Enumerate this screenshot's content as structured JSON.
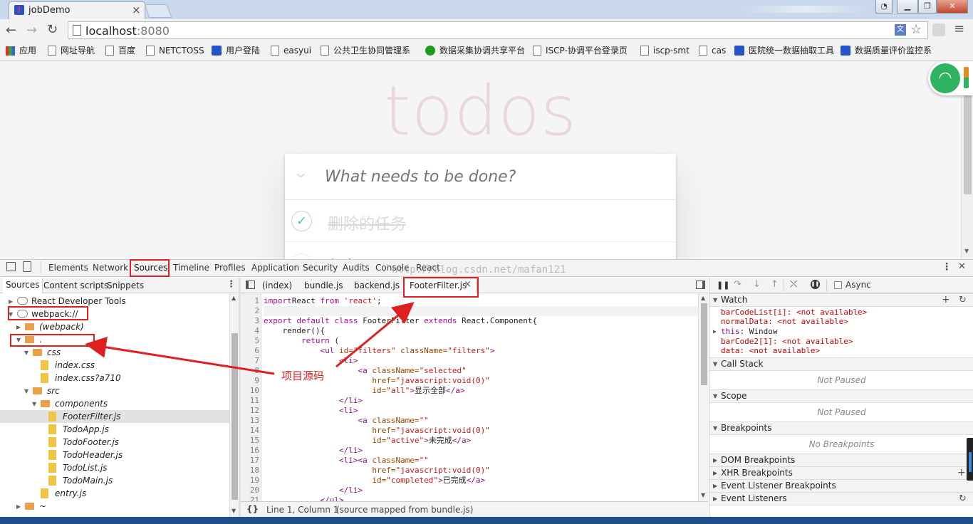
{
  "browser": {
    "tab_title": "jobDemo",
    "tab_close": "×",
    "url_host": "localhost",
    "url_port": ":8080",
    "bookmarks": [
      "应用",
      "网址导航",
      "百度",
      "NETCTOSS",
      "用户登陆",
      "easyui",
      "公共卫生协同管理系",
      "数据采集协调共享平台",
      "ISCP-协调平台登录页",
      "iscp-smt",
      "cas",
      "医院统一数据抽取工具",
      "数据质量评价监控系"
    ]
  },
  "app": {
    "title": "todos",
    "input_placeholder": "What needs to be done?",
    "items": [
      {
        "text": "删除的任务",
        "completed": true
      },
      {
        "text": "任务",
        "completed": false
      }
    ]
  },
  "devtools": {
    "tabs": [
      "Elements",
      "Network",
      "Sources",
      "Timeline",
      "Profiles",
      "Application",
      "Security",
      "Audits",
      "Console",
      "React"
    ],
    "watermark": "http://blog.csdn.net/mafan121",
    "navigator_tabs": [
      "Sources",
      "Content scripts",
      "Snippets"
    ],
    "tree": [
      {
        "label": "React Developer Tools",
        "depth": 0,
        "type": "cloud",
        "arrow": "▶"
      },
      {
        "label": "webpack://",
        "depth": 0,
        "type": "cloud",
        "arrow": "▼"
      },
      {
        "label": "(webpack)",
        "depth": 1,
        "type": "folder",
        "arrow": "▶"
      },
      {
        "label": ".",
        "depth": 1,
        "type": "folder",
        "arrow": "▼"
      },
      {
        "label": "css",
        "depth": 2,
        "type": "folder",
        "arrow": "▼"
      },
      {
        "label": "index.css",
        "depth": 3,
        "type": "file",
        "arrow": ""
      },
      {
        "label": "index.css?a710",
        "depth": 3,
        "type": "file",
        "arrow": ""
      },
      {
        "label": "src",
        "depth": 2,
        "type": "folder",
        "arrow": "▼"
      },
      {
        "label": "components",
        "depth": 3,
        "type": "folder",
        "arrow": "▼"
      },
      {
        "label": "FooterFilter.js",
        "depth": 4,
        "type": "file",
        "arrow": "",
        "selected": true
      },
      {
        "label": "TodoApp.js",
        "depth": 4,
        "type": "file",
        "arrow": ""
      },
      {
        "label": "TodoFooter.js",
        "depth": 4,
        "type": "file",
        "arrow": ""
      },
      {
        "label": "TodoHeader.js",
        "depth": 4,
        "type": "file",
        "arrow": ""
      },
      {
        "label": "TodoList.js",
        "depth": 4,
        "type": "file",
        "arrow": ""
      },
      {
        "label": "TodoMain.js",
        "depth": 4,
        "type": "file",
        "arrow": ""
      },
      {
        "label": "entry.js",
        "depth": 3,
        "type": "file",
        "arrow": ""
      },
      {
        "label": "~",
        "depth": 1,
        "type": "folder",
        "arrow": "▶"
      }
    ],
    "editor_tabs": [
      "(index)",
      "bundle.js",
      "backend.js",
      "FooterFilter.js"
    ],
    "editor_tab_close": "×",
    "code": [
      [
        [
          "kw",
          "import"
        ],
        [
          "",
          "React "
        ],
        [
          "kw",
          "from"
        ],
        [
          "str",
          " 'react'"
        ],
        [
          "",
          ";"
        ]
      ],
      [],
      [
        [
          "kw",
          "export default class"
        ],
        [
          "",
          " FooterFilter "
        ],
        [
          "kw",
          "extends"
        ],
        [
          "",
          " React.Component{"
        ]
      ],
      [
        [
          "",
          "    render(){"
        ]
      ],
      [
        [
          "",
          "        "
        ],
        [
          "kw",
          "return"
        ],
        [
          "",
          " ("
        ]
      ],
      [
        [
          "",
          "            "
        ],
        [
          "tag",
          "<ul"
        ],
        [
          "at",
          " id="
        ],
        [
          "str",
          "\"filters\""
        ],
        [
          "at",
          " className="
        ],
        [
          "str",
          "\"filters\""
        ],
        [
          "tag",
          ">"
        ]
      ],
      [
        [
          "",
          "                "
        ],
        [
          "tag",
          "<li>"
        ]
      ],
      [
        [
          "",
          "                    "
        ],
        [
          "tag",
          "<a"
        ],
        [
          "at",
          " className="
        ],
        [
          "str",
          "\"selected\""
        ]
      ],
      [
        [
          "",
          "                       "
        ],
        [
          "at",
          "href="
        ],
        [
          "str",
          "\"javascript:void(0)\""
        ]
      ],
      [
        [
          "",
          "                       "
        ],
        [
          "at",
          "id="
        ],
        [
          "str",
          "\"all\""
        ],
        [
          "tag",
          ">"
        ],
        [
          "",
          "显示全部"
        ],
        [
          "tag",
          "</a>"
        ]
      ],
      [
        [
          "",
          "                "
        ],
        [
          "tag",
          "</li>"
        ]
      ],
      [
        [
          "",
          "                "
        ],
        [
          "tag",
          "<li>"
        ]
      ],
      [
        [
          "",
          "                    "
        ],
        [
          "tag",
          "<a"
        ],
        [
          "at",
          " className="
        ],
        [
          "str",
          "\"\""
        ]
      ],
      [
        [
          "",
          "                       "
        ],
        [
          "at",
          "href="
        ],
        [
          "str",
          "\"javascript:void(0)\""
        ]
      ],
      [
        [
          "",
          "                       "
        ],
        [
          "at",
          "id="
        ],
        [
          "str",
          "\"active\""
        ],
        [
          "tag",
          ">"
        ],
        [
          "",
          "未完成"
        ],
        [
          "tag",
          "</a>"
        ]
      ],
      [
        [
          "",
          "                "
        ],
        [
          "tag",
          "</li>"
        ]
      ],
      [
        [
          "",
          "                "
        ],
        [
          "tag",
          "<li><a"
        ],
        [
          "at",
          " className="
        ],
        [
          "str",
          "\"\""
        ]
      ],
      [
        [
          "",
          "                       "
        ],
        [
          "at",
          "href="
        ],
        [
          "str",
          "\"javascript:void(0)\""
        ]
      ],
      [
        [
          "",
          "                       "
        ],
        [
          "at",
          "id="
        ],
        [
          "str",
          "\"completed\""
        ],
        [
          "tag",
          ">"
        ],
        [
          "",
          "已完成"
        ],
        [
          "tag",
          "</a>"
        ]
      ],
      [
        [
          "",
          "                "
        ],
        [
          "tag",
          "</li>"
        ]
      ],
      [
        [
          "",
          "            "
        ],
        [
          "tag",
          "</ul>"
        ]
      ]
    ],
    "status_braces": "{}",
    "status_position": "Line 1, Column 1",
    "status_source": "(source mapped from bundle.js)",
    "async_label": "Async",
    "watch_title": "Watch",
    "watch": [
      {
        "name": "barCodeList[i]",
        "value": "<not available>"
      },
      {
        "name": "normalData",
        "value": "<not available>"
      },
      {
        "name": "this",
        "value": "Window",
        "expandable": true
      },
      {
        "name": "barCode2[1]",
        "value": "<not available>"
      },
      {
        "name": "data",
        "value": "<not available>"
      }
    ],
    "callstack_title": "Call Stack",
    "not_paused": "Not Paused",
    "scope_title": "Scope",
    "breakpoints_title": "Breakpoints",
    "no_breakpoints": "No Breakpoints",
    "dom_bp": "DOM Breakpoints",
    "xhr_bp": "XHR Breakpoints",
    "event_bp": "Event Listener Breakpoints",
    "event_listeners": "Event Listeners"
  },
  "annotation": {
    "label": "项目源码",
    "color": "#e02020"
  }
}
